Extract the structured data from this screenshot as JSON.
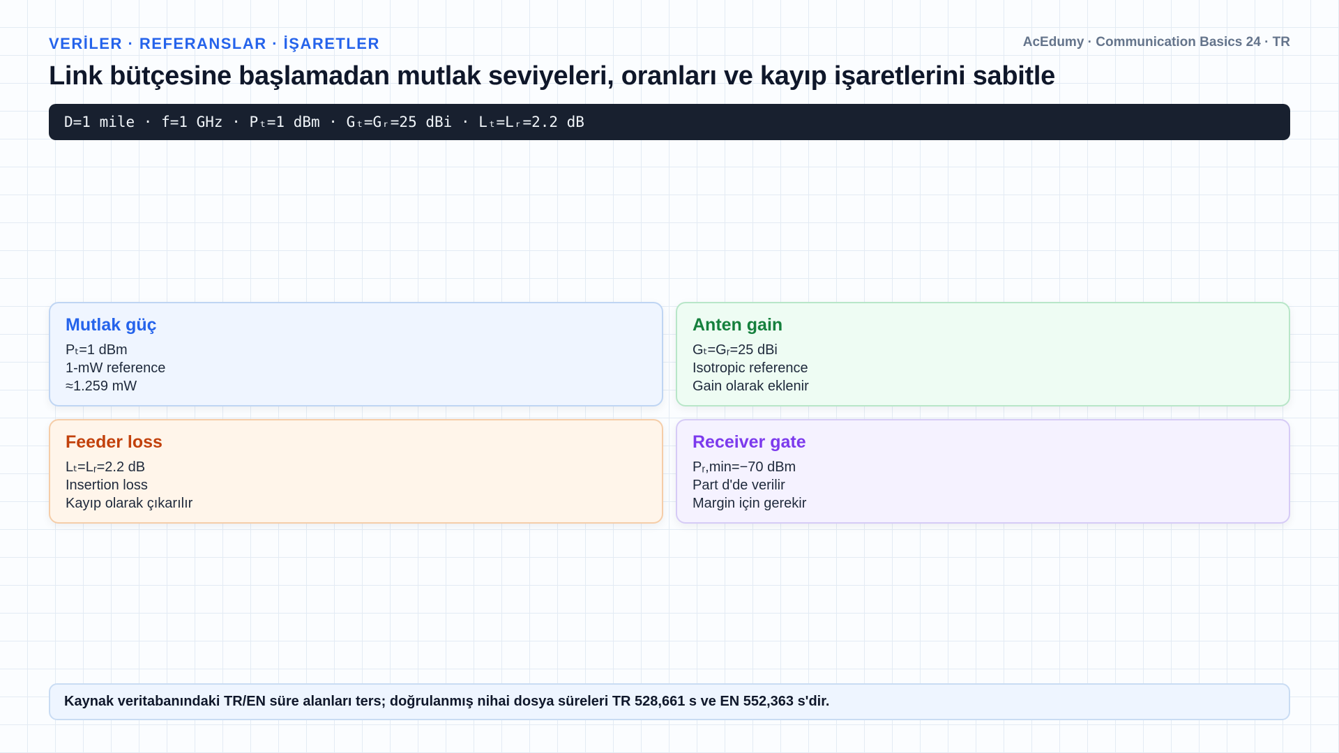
{
  "header": {
    "kicker": "VERİLER · REFERANSLAR · İŞARETLER",
    "brand": "AcEdumy · Communication Basics 24 · TR",
    "title": "Link bütçesine başlamadan mutlak seviyeleri, oranları ve kayıp işaretlerini sabitle"
  },
  "given": {
    "text": "D=1 mile · f=1 GHz · Pₜ=1 dBm · Gₜ=Gᵣ=25 dBi · Lₜ=Lᵣ=2.2 dB"
  },
  "cards": [
    {
      "title": "Mutlak güç",
      "color": "#2563eb",
      "lines": [
        "Pₜ=1 dBm",
        "1-mW reference",
        "≈1.259 mW"
      ]
    },
    {
      "title": "Anten gain",
      "color": "#15803d",
      "lines": [
        "Gₜ=Gᵣ=25 dBi",
        "Isotropic reference",
        "Gain olarak eklenir"
      ]
    },
    {
      "title": "Feeder loss",
      "color": "#c2410c",
      "lines": [
        "Lₜ=Lᵣ=2.2 dB",
        "Insertion loss",
        "Kayıp olarak çıkarılır"
      ]
    },
    {
      "title": "Receiver gate",
      "color": "#7c3aed",
      "lines": [
        "Pᵣ,min=−70 dBm",
        "Part d'de verilir",
        "Margin için gerekir"
      ]
    }
  ],
  "footer": {
    "note": "Kaynak veritabanındaki TR/EN süre alanları ters; doğrulanmış nihai dosya süreleri TR 528,661 s ve EN 552,363 s'dir."
  }
}
